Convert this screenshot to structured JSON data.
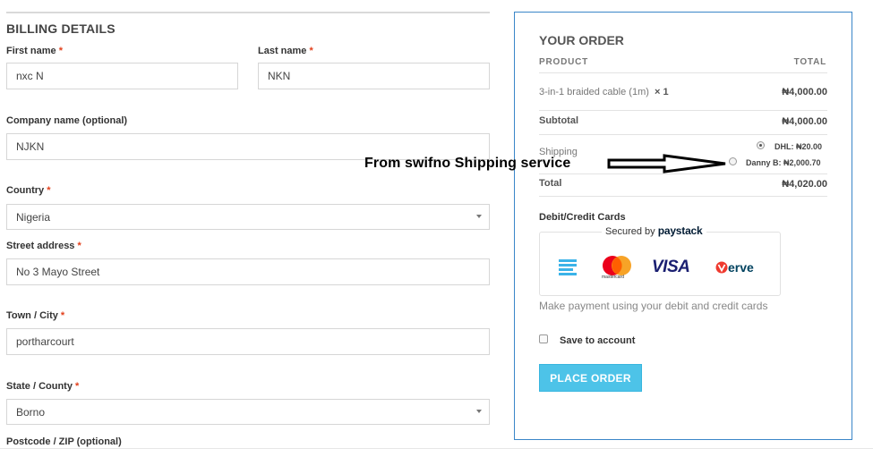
{
  "billing": {
    "title": "BILLING DETAILS",
    "required_mark": "*",
    "first_name": {
      "label": "First name",
      "value": "nxc N"
    },
    "last_name": {
      "label": "Last name",
      "value": "NKN"
    },
    "company": {
      "label": "Company name (optional)",
      "value": "NJKN"
    },
    "country": {
      "label": "Country",
      "value": "Nigeria"
    },
    "street": {
      "label": "Street address",
      "value": "No 3 Mayo Street"
    },
    "town": {
      "label": "Town / City",
      "value": "portharcourt"
    },
    "state": {
      "label": "State / County",
      "value": "Borno"
    },
    "postcode": {
      "label": "Postcode / ZIP (optional)"
    }
  },
  "order": {
    "title": "YOUR ORDER",
    "col_product": "PRODUCT",
    "col_total": "TOTAL",
    "item_name": "3-in-1 braided cable (1m)",
    "item_qty": "× 1",
    "item_total": "₦4,000.00",
    "subtotal_label": "Subtotal",
    "subtotal_value": "₦4,000.00",
    "shipping_label": "Shipping",
    "shipping_options": [
      {
        "label": "DHL: ₦20.00",
        "selected": true
      },
      {
        "label": "Danny B: ₦2,000.70",
        "selected": false
      }
    ],
    "total_label": "Total",
    "total_value": "₦4,020.00"
  },
  "annotation": {
    "text": "From swifno Shipping service"
  },
  "payment": {
    "method_label": "Debit/Credit Cards",
    "secured_prefix": "Secured by",
    "secured_brand": "paystack",
    "mastercard_text": "mastercard",
    "visa_text": "VISA",
    "verve_text": "erve",
    "description": "Make payment using your debit and credit cards",
    "save_label": "Save to account",
    "place_order": "PLACE ORDER"
  },
  "colors": {
    "accent_button": "#4dc3e8",
    "order_border": "#3a86c8",
    "required": "#e2401c",
    "visa": "#1a1f71",
    "verve": "#ef3a2f"
  }
}
